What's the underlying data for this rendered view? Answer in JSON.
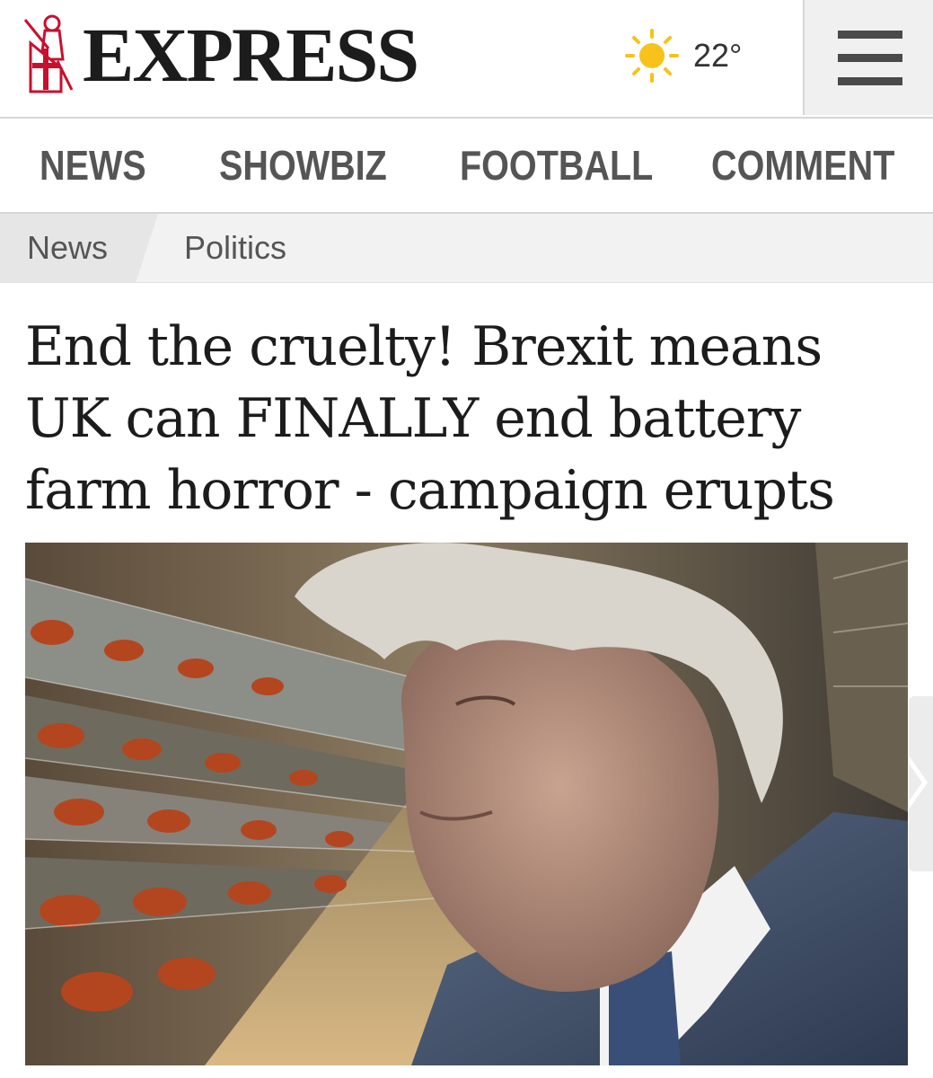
{
  "header": {
    "logo_text": "EXPRESS",
    "weather": {
      "icon": "sun-icon",
      "temperature": "22°"
    },
    "menu_icon": "hamburger-menu-icon"
  },
  "nav": {
    "items": [
      {
        "label": "NEWS"
      },
      {
        "label": "SHOWBIZ"
      },
      {
        "label": "FOOTBALL"
      },
      {
        "label": "COMMENT"
      }
    ]
  },
  "breadcrumb": {
    "items": [
      {
        "label": "News"
      },
      {
        "label": "Politics"
      }
    ]
  },
  "article": {
    "headline": "End the cruelty! Brexit means UK can FINALLY end battery farm horror - campaign erupts",
    "gallery_next_icon": "chevron-right-icon"
  },
  "colors": {
    "logo_red": "#c8102e",
    "text_dark": "#1c1c1c",
    "nav_text": "#555555",
    "sun_yellow": "#f7c31a"
  }
}
